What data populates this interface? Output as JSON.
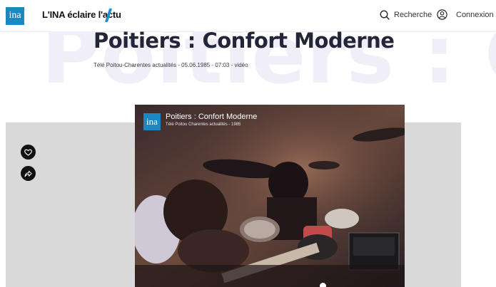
{
  "header": {
    "logo_text": "ina",
    "brand": "L'INA éclaire l'actu",
    "search_label": "Recherche",
    "login_label": "Connexion",
    "accent_color": "#1f8fd0"
  },
  "article": {
    "watermark": "Poitiers : Confort Moderne",
    "title": "Poitiers : Confort Moderne",
    "meta": "Télé Poitou-Charentes actualités - 05.06.1985 - 07:03 - vidéo"
  },
  "actions": {
    "favorite_icon": "heart-icon",
    "share_icon": "share-icon"
  },
  "video": {
    "logo_text": "ina",
    "title": "Poitiers : Confort Moderne",
    "subtitle": "Télé Poitou Charentes actualités - 1985"
  }
}
